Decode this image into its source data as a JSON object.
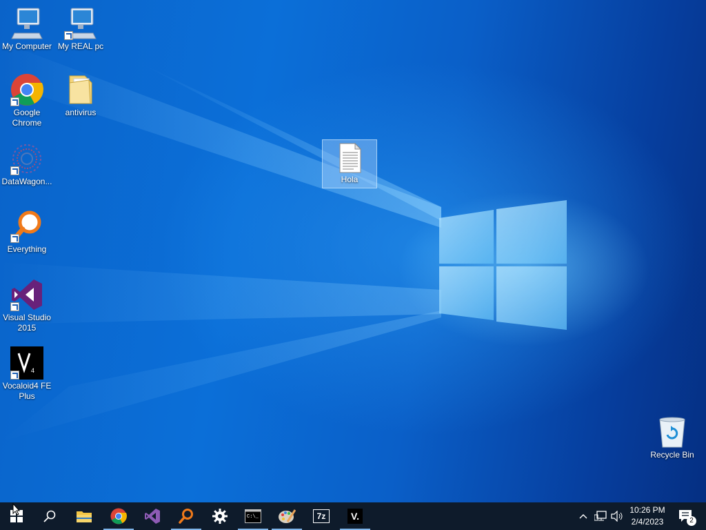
{
  "desktop": {
    "icons": [
      {
        "label": "My Computer",
        "icon": "computer-icon"
      },
      {
        "label": "My REAL pc",
        "icon": "computer-icon"
      },
      {
        "label": "Google Chrome",
        "icon": "chrome-icon"
      },
      {
        "label": "antivirus",
        "icon": "folder-icon"
      },
      {
        "label": "DataWagon...",
        "icon": "datawagon-icon"
      },
      {
        "label": "Everything",
        "icon": "everything-search-icon"
      },
      {
        "label": "Visual Studio 2015",
        "icon": "visual-studio-icon"
      },
      {
        "label": "Vocaloid4 FE Plus",
        "icon": "vocaloid-icon"
      },
      {
        "label": "Hola",
        "icon": "text-document-icon"
      },
      {
        "label": "Recycle Bin",
        "icon": "recycle-bin-icon"
      }
    ]
  },
  "taskbar": {
    "pinned": [
      {
        "name": "start",
        "icon": "windows-logo-icon"
      },
      {
        "name": "search",
        "icon": "search-icon"
      },
      {
        "name": "file-explorer",
        "icon": "file-explorer-icon"
      },
      {
        "name": "chrome",
        "icon": "chrome-icon"
      },
      {
        "name": "visual-studio",
        "icon": "visual-studio-icon"
      },
      {
        "name": "everything",
        "icon": "everything-search-icon"
      },
      {
        "name": "settings",
        "icon": "gear-icon"
      },
      {
        "name": "command-prompt",
        "icon": "cmd-icon"
      },
      {
        "name": "paint",
        "icon": "paint-palette-icon"
      },
      {
        "name": "7zip",
        "icon": "7zip-icon",
        "text": "7z"
      },
      {
        "name": "vocaloid",
        "icon": "vocaloid-icon",
        "text": "V."
      }
    ],
    "tray": {
      "time": "10:26 PM",
      "date": "2/4/2023",
      "notification_count": "2"
    }
  },
  "colors": {
    "taskbar": "#0e1b2b",
    "desktop_blue": "#0a63c9",
    "running_indicator": "#7fb5ea"
  }
}
